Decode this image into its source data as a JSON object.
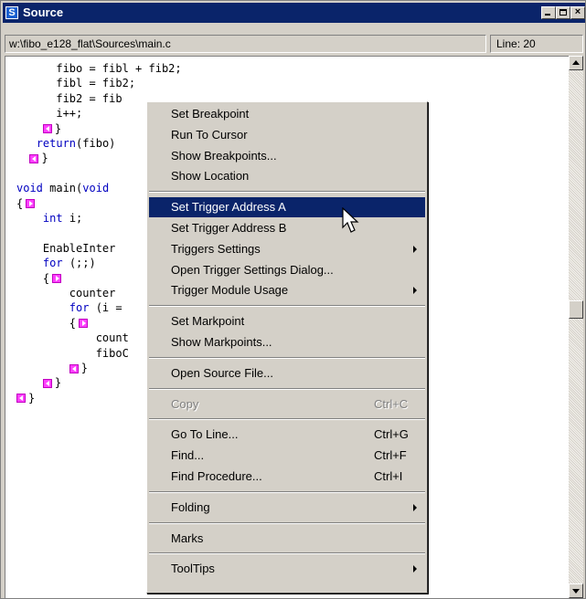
{
  "window": {
    "title": "Source",
    "app_icon": "S"
  },
  "status": {
    "path": "w:\\fibo_e128_flat\\Sources\\main.c",
    "line": "Line: 20"
  },
  "code": [
    {
      "segments": [
        {
          "t": "      fibo = fibl + fib2;"
        }
      ]
    },
    {
      "segments": [
        {
          "t": "      fibl = fib2;"
        }
      ]
    },
    {
      "segments": [
        {
          "t": "      fib2 = fib"
        }
      ]
    },
    {
      "segments": [
        {
          "t": "      i++;"
        }
      ]
    },
    {
      "marker": "left",
      "indent": 4,
      "segments": [
        {
          "t": "}"
        }
      ]
    },
    {
      "segments": [
        {
          "t": "   "
        },
        {
          "t": "return",
          "kw": true
        },
        {
          "t": "(fibo)"
        }
      ]
    },
    {
      "marker": "left",
      "indent": 2,
      "segments": [
        {
          "t": "}"
        }
      ]
    },
    {
      "segments": [
        {
          "t": ""
        }
      ]
    },
    {
      "segments": [
        {
          "t": "void",
          "kw": true
        },
        {
          "t": " main("
        },
        {
          "t": "void",
          "kw": true
        }
      ]
    },
    {
      "marker": "right",
      "indent": 0,
      "prefix": "{ ",
      "segments": [
        {
          "t": ""
        }
      ]
    },
    {
      "segments": [
        {
          "t": "    "
        },
        {
          "t": "int",
          "kw": true
        },
        {
          "t": " i;"
        }
      ]
    },
    {
      "segments": [
        {
          "t": ""
        }
      ]
    },
    {
      "segments": [
        {
          "t": "    EnableInter"
        }
      ]
    },
    {
      "segments": [
        {
          "t": "    "
        },
        {
          "t": "for",
          "kw": true
        },
        {
          "t": " (;;)"
        }
      ]
    },
    {
      "marker": "right",
      "indent": 4,
      "prefix": "{ ",
      "segments": [
        {
          "t": ""
        }
      ]
    },
    {
      "segments": [
        {
          "t": "        counter"
        }
      ]
    },
    {
      "segments": [
        {
          "t": "        "
        },
        {
          "t": "for",
          "kw": true
        },
        {
          "t": " (i ="
        }
      ]
    },
    {
      "marker": "right",
      "indent": 8,
      "prefix": "{ ",
      "segments": [
        {
          "t": ""
        }
      ]
    },
    {
      "segments": [
        {
          "t": "            count"
        }
      ]
    },
    {
      "segments": [
        {
          "t": "            fiboC"
        }
      ]
    },
    {
      "marker": "left",
      "indent": 8,
      "segments": [
        {
          "t": "}"
        }
      ]
    },
    {
      "marker": "left",
      "indent": 4,
      "segments": [
        {
          "t": "}"
        }
      ]
    },
    {
      "marker": "left",
      "indent": 0,
      "segments": [
        {
          "t": "}"
        }
      ]
    }
  ],
  "menu": {
    "items": [
      {
        "id": "set-breakpoint",
        "label": "Set Breakpoint"
      },
      {
        "id": "run-to-cursor",
        "label": "Run To Cursor"
      },
      {
        "id": "show-breakpoints",
        "label": "Show Breakpoints..."
      },
      {
        "id": "show-location",
        "label": "Show Location"
      },
      {
        "sep": true
      },
      {
        "id": "set-trigger-a",
        "label": "Set Trigger Address A",
        "highlighted": true
      },
      {
        "id": "set-trigger-b",
        "label": "Set Trigger Address B"
      },
      {
        "id": "triggers-settings",
        "label": "Triggers Settings",
        "submenu": true
      },
      {
        "id": "open-trigger-dialog",
        "label": "Open Trigger Settings Dialog..."
      },
      {
        "id": "trigger-module-usage",
        "label": "Trigger Module Usage",
        "submenu": true
      },
      {
        "sep": true
      },
      {
        "id": "set-markpoint",
        "label": "Set Markpoint"
      },
      {
        "id": "show-markpoints",
        "label": "Show Markpoints..."
      },
      {
        "sep": true
      },
      {
        "id": "open-source-file",
        "label": "Open Source File..."
      },
      {
        "sep": true
      },
      {
        "id": "copy",
        "label": "Copy",
        "shortcut": "Ctrl+C",
        "disabled": true
      },
      {
        "sep": true
      },
      {
        "id": "go-to-line",
        "label": "Go To Line...",
        "shortcut": "Ctrl+G"
      },
      {
        "id": "find",
        "label": "Find...",
        "shortcut": "Ctrl+F"
      },
      {
        "id": "find-procedure",
        "label": "Find Procedure...",
        "shortcut": "Ctrl+I"
      },
      {
        "sep": true
      },
      {
        "id": "folding",
        "label": "Folding",
        "submenu": true
      },
      {
        "sep": true
      },
      {
        "id": "marks",
        "label": "Marks"
      },
      {
        "sep": true
      },
      {
        "id": "tooltips",
        "label": "ToolTips",
        "submenu": true
      }
    ]
  },
  "colors": {
    "title_bar": "#0a246a",
    "keyword": "#0000c0",
    "marker": "#ff40ff",
    "menu_highlight": "#0a246a"
  },
  "icons": {
    "minimize": "minimize-icon",
    "maximize": "maximize-icon",
    "close": "close-icon"
  }
}
